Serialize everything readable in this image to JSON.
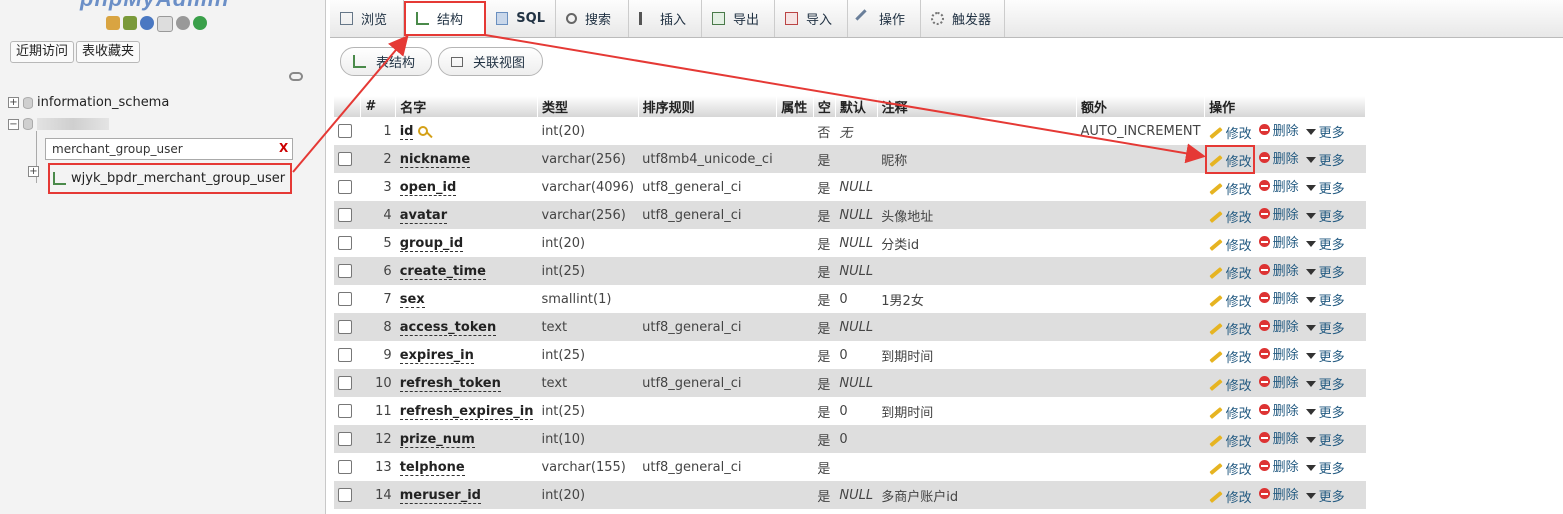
{
  "nav": {
    "logo": "phpMyAdmin",
    "recent_label": "近期访问",
    "favorites_label": "表收藏夹",
    "tree": {
      "db1": "information_schema",
      "filter_value": "merchant_group_user",
      "filter_clear": "X",
      "table_name": "wjyk_bpdr_merchant_group_user"
    }
  },
  "tabs": [
    {
      "label": "浏览",
      "icon": "browse-icon"
    },
    {
      "label": "结构",
      "icon": "structure-icon"
    },
    {
      "label": "SQL",
      "icon": "sql-icon"
    },
    {
      "label": "搜索",
      "icon": "search-icon"
    },
    {
      "label": "插入",
      "icon": "insert-icon"
    },
    {
      "label": "导出",
      "icon": "export-icon"
    },
    {
      "label": "导入",
      "icon": "import-icon"
    },
    {
      "label": "操作",
      "icon": "wrench-icon"
    },
    {
      "label": "触发器",
      "icon": "trigger-icon"
    }
  ],
  "subnav": {
    "table_structure": "表结构",
    "relation_view": "关联视图"
  },
  "table": {
    "headers": {
      "num": "#",
      "name": "名字",
      "type": "类型",
      "collation": "排序规则",
      "attributes": "属性",
      "null": "空",
      "default": "默认",
      "comment": "注释",
      "extra": "额外",
      "action": "操作"
    },
    "actions": {
      "edit": "修改",
      "drop": "删除",
      "more": "更多"
    },
    "rows": [
      {
        "num": "1",
        "name": "id",
        "type": "int(20)",
        "collation": "",
        "null": "否",
        "default": "无",
        "comment": "",
        "extra": "AUTO_INCREMENT",
        "primary": true
      },
      {
        "num": "2",
        "name": "nickname",
        "type": "varchar(256)",
        "collation": "utf8mb4_unicode_ci",
        "null": "是",
        "default": "",
        "comment": "昵称",
        "extra": ""
      },
      {
        "num": "3",
        "name": "open_id",
        "type": "varchar(4096)",
        "collation": "utf8_general_ci",
        "null": "是",
        "default": "NULL",
        "comment": "",
        "extra": ""
      },
      {
        "num": "4",
        "name": "avatar",
        "type": "varchar(256)",
        "collation": "utf8_general_ci",
        "null": "是",
        "default": "NULL",
        "comment": "头像地址",
        "extra": ""
      },
      {
        "num": "5",
        "name": "group_id",
        "type": "int(20)",
        "collation": "",
        "null": "是",
        "default": "NULL",
        "comment": "分类id",
        "extra": ""
      },
      {
        "num": "6",
        "name": "create_time",
        "type": "int(25)",
        "collation": "",
        "null": "是",
        "default": "NULL",
        "comment": "",
        "extra": ""
      },
      {
        "num": "7",
        "name": "sex",
        "type": "smallint(1)",
        "collation": "",
        "null": "是",
        "default": "0",
        "comment": "1男2女",
        "extra": ""
      },
      {
        "num": "8",
        "name": "access_token",
        "type": "text",
        "collation": "utf8_general_ci",
        "null": "是",
        "default": "NULL",
        "comment": "",
        "extra": ""
      },
      {
        "num": "9",
        "name": "expires_in",
        "type": "int(25)",
        "collation": "",
        "null": "是",
        "default": "0",
        "comment": "到期时间",
        "extra": ""
      },
      {
        "num": "10",
        "name": "refresh_token",
        "type": "text",
        "collation": "utf8_general_ci",
        "null": "是",
        "default": "NULL",
        "comment": "",
        "extra": ""
      },
      {
        "num": "11",
        "name": "refresh_expires_in",
        "type": "int(25)",
        "collation": "",
        "null": "是",
        "default": "0",
        "comment": "到期时间",
        "extra": ""
      },
      {
        "num": "12",
        "name": "prize_num",
        "type": "int(10)",
        "collation": "",
        "null": "是",
        "default": "0",
        "comment": "",
        "extra": ""
      },
      {
        "num": "13",
        "name": "telphone",
        "type": "varchar(155)",
        "collation": "utf8_general_ci",
        "null": "是",
        "default": "",
        "comment": "",
        "extra": ""
      },
      {
        "num": "14",
        "name": "meruser_id",
        "type": "int(20)",
        "collation": "",
        "null": "是",
        "default": "NULL",
        "comment": "多商户账户id",
        "extra": ""
      }
    ]
  },
  "colors": {
    "highlight": "#e53935",
    "link": "#235a81"
  }
}
